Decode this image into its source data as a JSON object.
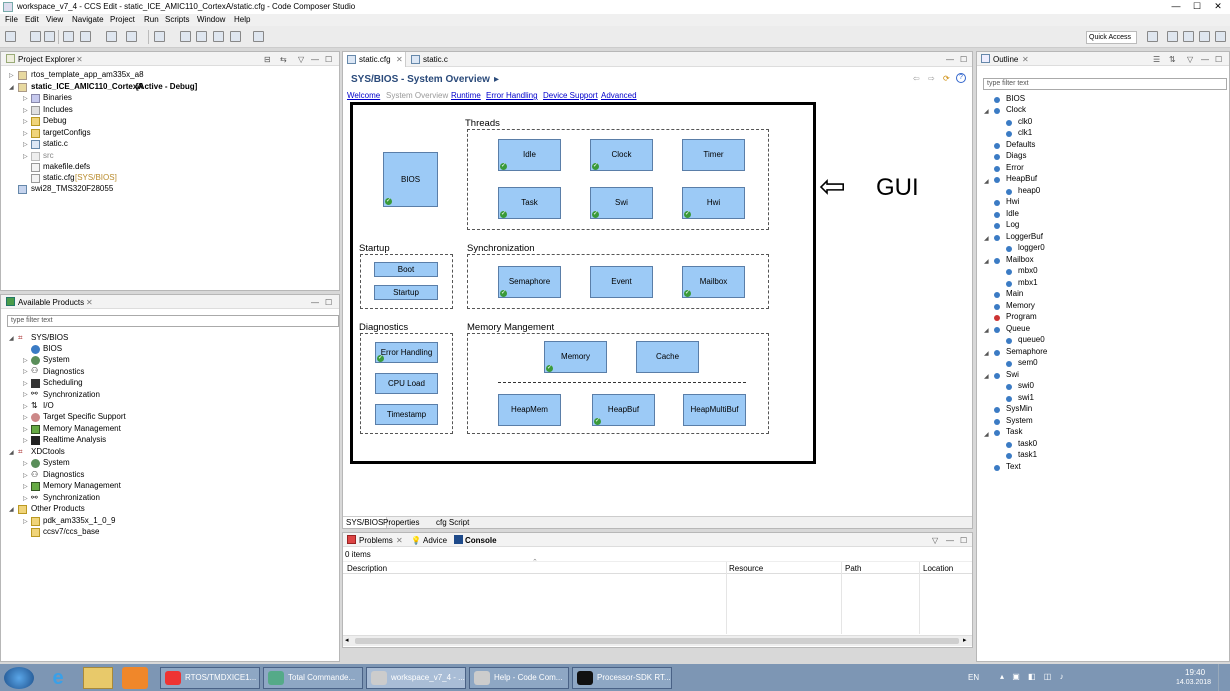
{
  "window": {
    "title": "workspace_v7_4 - CCS Edit - static_ICE_AMIC110_CortexA/static.cfg - Code Composer Studio",
    "minimize": "—",
    "maximize": "☐",
    "close": "✕"
  },
  "menu": [
    "File",
    "Edit",
    "View",
    "Navigate",
    "Project",
    "Run",
    "Scripts",
    "Window",
    "Help"
  ],
  "quick_access": "Quick Access",
  "project_explorer": {
    "title": "Project Explorer",
    "items": [
      "rtos_template_app_am335x_a8",
      "static_ICE_AMIC110_CortexA",
      "[Active - Debug]",
      "Binaries",
      "Includes",
      "Debug",
      "targetConfigs",
      "static.c",
      "src",
      "makefile.defs",
      "static.cfg",
      "[SYS/BIOS]",
      "swi28_TMS320F28055"
    ]
  },
  "available_products": {
    "title": "Available Products",
    "filter_placeholder": "type filter text",
    "items": [
      "SYS/BIOS",
      "BIOS",
      "System",
      "Diagnostics",
      "Scheduling",
      "Synchronization",
      "I/O",
      "Target Specific Support",
      "Memory Management",
      "Realtime Analysis",
      "XDCtools",
      "System",
      "Diagnostics",
      "Memory Management",
      "Synchronization",
      "Other Products",
      "pdk_am335x_1_0_9",
      "ccsv7/ccs_base"
    ]
  },
  "editor": {
    "tabs": [
      "static.cfg",
      "static.c"
    ],
    "heading": "SYS/BIOS - System Overview",
    "heading_arrow": "▸",
    "nav_links": [
      "Welcome",
      "System Overview",
      "Runtime",
      "Error Handling",
      "Device Support",
      "Advanced"
    ],
    "groups": {
      "threads": "Threads",
      "startup": "Startup",
      "sync": "Synchronization",
      "diag": "Diagnostics",
      "mem": "Memory Mangement"
    },
    "boxes": {
      "bios": "BIOS",
      "idle": "Idle",
      "clock": "Clock",
      "timer": "Timer",
      "task": "Task",
      "swi": "Swi",
      "hwi": "Hwi",
      "boot": "Boot",
      "startup": "Startup",
      "semaphore": "Semaphore",
      "event": "Event",
      "mailbox": "Mailbox",
      "errorhandling": "Error Handling",
      "cpuload": "CPU Load",
      "timestamp": "Timestamp",
      "memory": "Memory",
      "cache": "Cache",
      "heapmem": "HeapMem",
      "heapbuf": "HeapBuf",
      "heapmultibuf": "HeapMultiBuf"
    },
    "checkmark": "✓",
    "annotation": {
      "arrow": "⇦",
      "label": "GUI"
    },
    "bottom_tabs": [
      "SYS/BIOS",
      "Properties",
      "cfg Script"
    ]
  },
  "problems": {
    "tabs": [
      "Problems",
      "Advice",
      "Console"
    ],
    "count": "0 items",
    "columns": [
      "Description",
      "Resource",
      "Path",
      "Location"
    ]
  },
  "outline": {
    "title": "Outline",
    "filter_placeholder": "type filter text",
    "items": [
      "BIOS",
      "Clock",
      "clk0",
      "clk1",
      "Defaults",
      "Diags",
      "Error",
      "HeapBuf",
      "heap0",
      "Hwi",
      "Idle",
      "Log",
      "LoggerBuf",
      "logger0",
      "Mailbox",
      "mbx0",
      "mbx1",
      "Main",
      "Memory",
      "Program",
      "Queue",
      "queue0",
      "Semaphore",
      "sem0",
      "Swi",
      "swi0",
      "swi1",
      "SysMin",
      "System",
      "Task",
      "task0",
      "task1",
      "Text"
    ]
  },
  "taskbar": {
    "tasks": [
      "RTOS/TMDXICE1...",
      "Total Commande...",
      "workspace_v7_4 - ...",
      "Help - Code Com...",
      "Processor-SDK RT..."
    ],
    "lang": "EN",
    "time": "19:40",
    "date": "14.03.2018"
  },
  "colors": {
    "box_fill": "#9ccaf6",
    "box_border": "#5a7ea8",
    "link": "#0000cc",
    "check": "#3a9a3a"
  }
}
